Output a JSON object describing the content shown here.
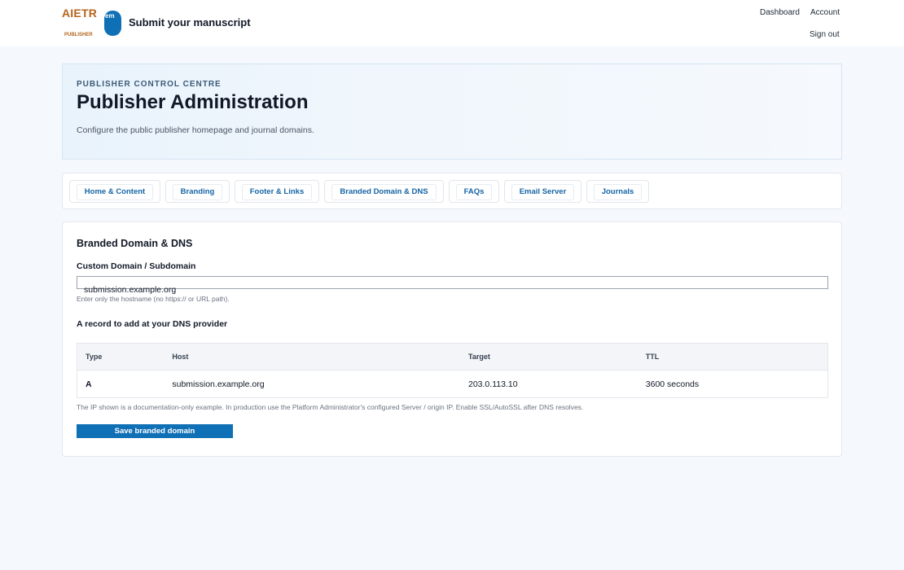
{
  "header": {
    "logo_text": "AIETR",
    "logo_subtext": "PUBLISHER",
    "logo_badge": "em",
    "title": "Submit your manuscript",
    "nav": {
      "dashboard": "Dashboard",
      "account": "Account",
      "sign_out": "Sign out"
    }
  },
  "hero": {
    "eyebrow": "PUBLISHER CONTROL CENTRE",
    "title": "Publisher Administration",
    "description": "Configure the public publisher homepage and journal domains."
  },
  "tabs": [
    {
      "label": "Home & Content"
    },
    {
      "label": "Branding"
    },
    {
      "label": "Footer & Links"
    },
    {
      "label": "Branded Domain & DNS"
    },
    {
      "label": "FAQs"
    },
    {
      "label": "Email Server"
    },
    {
      "label": "Journals"
    }
  ],
  "domain_section": {
    "title": "Branded Domain & DNS",
    "field_label": "Custom Domain / Subdomain",
    "field_value": "submission.example.org",
    "field_hint": "Enter only the hostname (no https:// or URL path).",
    "record_title": "A record to add at your DNS provider",
    "table": {
      "headers": {
        "type": "Type",
        "host": "Host",
        "target": "Target",
        "ttl": "TTL"
      },
      "rows": [
        {
          "type": "A",
          "host": "submission.example.org",
          "target": "203.0.113.10",
          "ttl": "3600 seconds"
        }
      ]
    },
    "footnote": "The IP shown is a documentation-only example. In production use the Platform Administrator's configured Server / origin IP. Enable SSL/AutoSSL after DNS resolves.",
    "save_label": "Save branded domain"
  },
  "colors": {
    "accent": "#1070b5",
    "logo": "#b5651d",
    "tab_text": "#1565a6"
  }
}
